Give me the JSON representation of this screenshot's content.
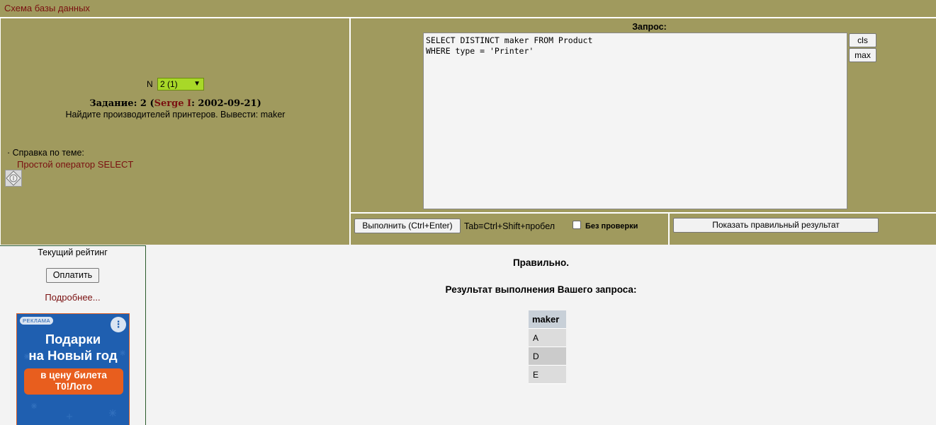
{
  "topbar": {
    "schema_link": "Схема базы данных"
  },
  "task": {
    "n_label": "N",
    "selected": "2 (1)",
    "title_prefix": "Задание: 2 (",
    "author": "Serge I",
    "title_suffix": ": 2002-09-21)",
    "description": "Найдите производителей принтеров. Вывести: maker",
    "help_label": "· Справка по теме:",
    "help_link": "Простой оператор SELECT"
  },
  "query": {
    "label": "Запрос:",
    "text": "SELECT DISTINCT maker FROM Product\nWHERE type = 'Printer'",
    "cls_label": "cls",
    "max_label": "max"
  },
  "actions": {
    "run_label": "Выполнить (Ctrl+Enter)",
    "shortcut_hint": "Tab≡Ctrl+Shift+пробел",
    "nocheck_label": "Без проверки",
    "nocheck_checked": false,
    "show_result_label": "Показать правильный результат"
  },
  "sidebar": {
    "rating_label": "Текущий рейтинг",
    "pay_label": "Оплатить",
    "more_link": "Подробнее...",
    "ad": {
      "badge": "РЕКЛАМА",
      "menu": "⋮",
      "title_line1": "Подарки",
      "title_line2": "на Новый год",
      "cta_line1": "в цену билета",
      "cta_line2": "Т0!Лото"
    }
  },
  "result": {
    "status": "Правильно.",
    "title": "Результат выполнения Вашего запроса:",
    "column": "maker",
    "rows": [
      "A",
      "D",
      "E"
    ]
  }
}
